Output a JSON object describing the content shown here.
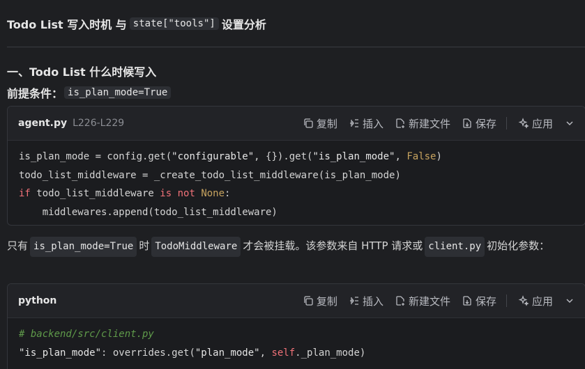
{
  "title": {
    "prefix": "Todo List 写入时机 与",
    "code": "state[\"tools\"]",
    "suffix": "设置分析"
  },
  "section1": {
    "heading": "一、Todo List 什么时候写入",
    "precondition_label": "前提条件：",
    "precondition_code": "is_plan_mode=True"
  },
  "toolbar": {
    "copy": "复制",
    "insert": "插入",
    "new_file": "新建文件",
    "save": "保存",
    "apply": "应用"
  },
  "codeblock1": {
    "file": "agent.py",
    "range": "L226-L229",
    "lines": [
      "is_plan_mode = config.get(\"configurable\", {}).get(\"is_plan_mode\", False)",
      "todo_list_middleware = _create_todo_list_middleware(is_plan_mode)",
      "if todo_list_middleware is not None:",
      "    middlewares.append(todo_list_middleware)"
    ]
  },
  "paragraph": {
    "t1": "只有",
    "c1": "is_plan_mode=True",
    "t2": "时",
    "c2": "TodoMiddleware",
    "t3": "才会被挂载。该参数来自 HTTP 请求或",
    "c3": "client.py",
    "t4": "初始化参数："
  },
  "codeblock2": {
    "file": "python",
    "lines": [
      "# backend/src/client.py",
      "\"is_plan_mode\": overrides.get(\"plan_mode\", self._plan_mode)"
    ]
  }
}
